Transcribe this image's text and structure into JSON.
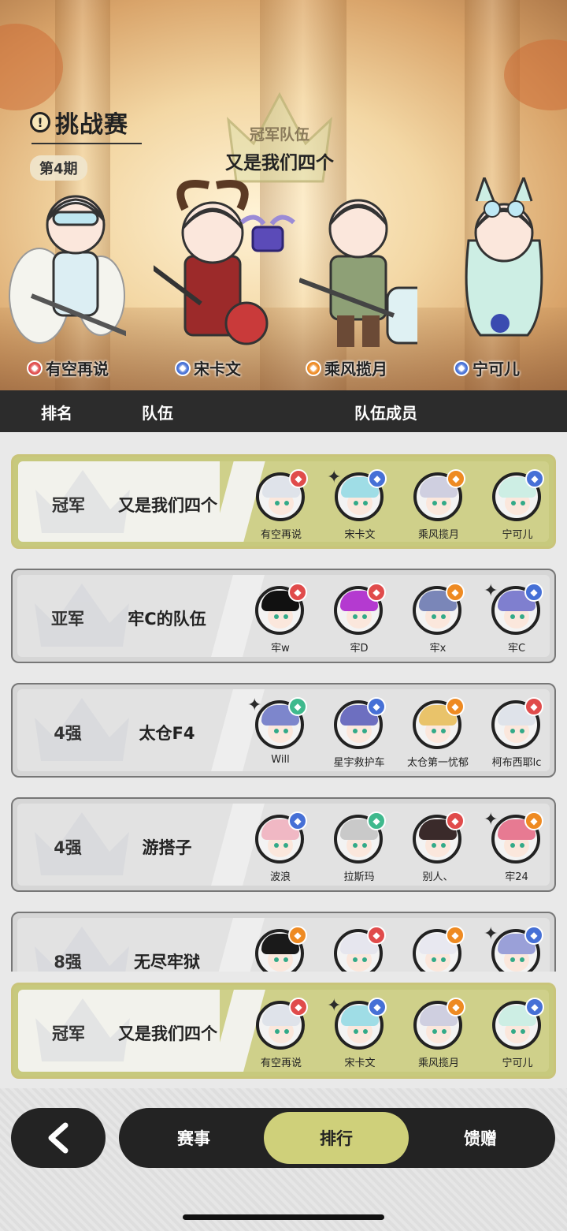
{
  "hero": {
    "title": "挑战赛",
    "title_icon": "!",
    "period": "第4期",
    "champion_label": "冠军队伍",
    "champion_team": "又是我们四个",
    "characters": [
      {
        "name": "有空再说",
        "element": "fire",
        "color": "#e04b4b"
      },
      {
        "name": "宋卡文",
        "element": "water",
        "color": "#4670d6"
      },
      {
        "name": "乘风揽月",
        "element": "thunder",
        "color": "#ee8a22"
      },
      {
        "name": "宁可儿",
        "element": "water",
        "color": "#4670d6"
      }
    ]
  },
  "table_header": {
    "rank": "排名",
    "team": "队伍",
    "members": "队伍成员"
  },
  "rows": [
    {
      "rank": "冠军",
      "team": "又是我们四个",
      "highlight": true,
      "members": [
        {
          "name": "有空再说",
          "element": "fire",
          "star": false,
          "hair": "#dfe3ea"
        },
        {
          "name": "宋卡文",
          "element": "water",
          "star": true,
          "hair": "#9fdde6"
        },
        {
          "name": "乘风揽月",
          "element": "thunder",
          "star": false,
          "hair": "#cfcfe0"
        },
        {
          "name": "宁可儿",
          "element": "water",
          "star": false,
          "hair": "#cdeee4"
        }
      ]
    },
    {
      "rank": "亚军",
      "team": "牢C的队伍",
      "highlight": false,
      "members": [
        {
          "name": "牢w",
          "element": "fire",
          "star": false,
          "hair": "#111111"
        },
        {
          "name": "牢D",
          "element": "fire",
          "star": false,
          "hair": "#b43ad0"
        },
        {
          "name": "牢x",
          "element": "thunder",
          "star": false,
          "hair": "#7a86b8"
        },
        {
          "name": "牢C",
          "element": "water",
          "star": true,
          "hair": "#7f7fcf"
        }
      ]
    },
    {
      "rank": "4强",
      "team": "太仓F4",
      "highlight": false,
      "members": [
        {
          "name": "Will",
          "element": "wind",
          "star": true,
          "hair": "#7d86cc"
        },
        {
          "name": "星宇救护车",
          "element": "water",
          "star": false,
          "hair": "#6d6fc0"
        },
        {
          "name": "太仓第一忧郁",
          "element": "thunder",
          "star": false,
          "hair": "#e9c36a"
        },
        {
          "name": "柯布西耶lc",
          "element": "fire",
          "star": false,
          "hair": "#dfe3ea"
        }
      ]
    },
    {
      "rank": "4强",
      "team": "游搭子",
      "highlight": false,
      "members": [
        {
          "name": "波浪",
          "element": "water",
          "star": false,
          "hair": "#f0b8c4"
        },
        {
          "name": "拉斯玛",
          "element": "wind",
          "star": false,
          "hair": "#c9c9c9"
        },
        {
          "name": "别人、",
          "element": "fire",
          "star": false,
          "hair": "#3a2a2a"
        },
        {
          "name": "牢24",
          "element": "thunder",
          "star": true,
          "hair": "#e77a92"
        }
      ]
    },
    {
      "rank": "8强",
      "team": "无尽牢狱",
      "highlight": false,
      "members": [
        {
          "name": "",
          "element": "thunder",
          "star": false,
          "hair": "#1a1a1a"
        },
        {
          "name": "",
          "element": "fire",
          "star": false,
          "hair": "#e6e6ee"
        },
        {
          "name": "",
          "element": "thunder",
          "star": false,
          "hair": "#e8e8f0"
        },
        {
          "name": "",
          "element": "water",
          "star": true,
          "hair": "#9aa0d8"
        }
      ]
    }
  ],
  "pinned": {
    "rank": "冠军",
    "team": "又是我们四个",
    "members": [
      {
        "name": "有空再说",
        "element": "fire",
        "star": false,
        "hair": "#dfe3ea"
      },
      {
        "name": "宋卡文",
        "element": "water",
        "star": true,
        "hair": "#9fdde6"
      },
      {
        "name": "乘风揽月",
        "element": "thunder",
        "star": false,
        "hair": "#cfcfe0"
      },
      {
        "name": "宁可儿",
        "element": "water",
        "star": false,
        "hair": "#cdeee4"
      }
    ]
  },
  "nav": {
    "back_icon": "chevron-left-icon",
    "tabs": [
      "赛事",
      "排行",
      "馈赠"
    ],
    "active_tab": "排行"
  },
  "element_colors": {
    "fire": "#e04b4b",
    "water": "#4670d6",
    "thunder": "#ee8a22",
    "wind": "#3fb98d"
  }
}
